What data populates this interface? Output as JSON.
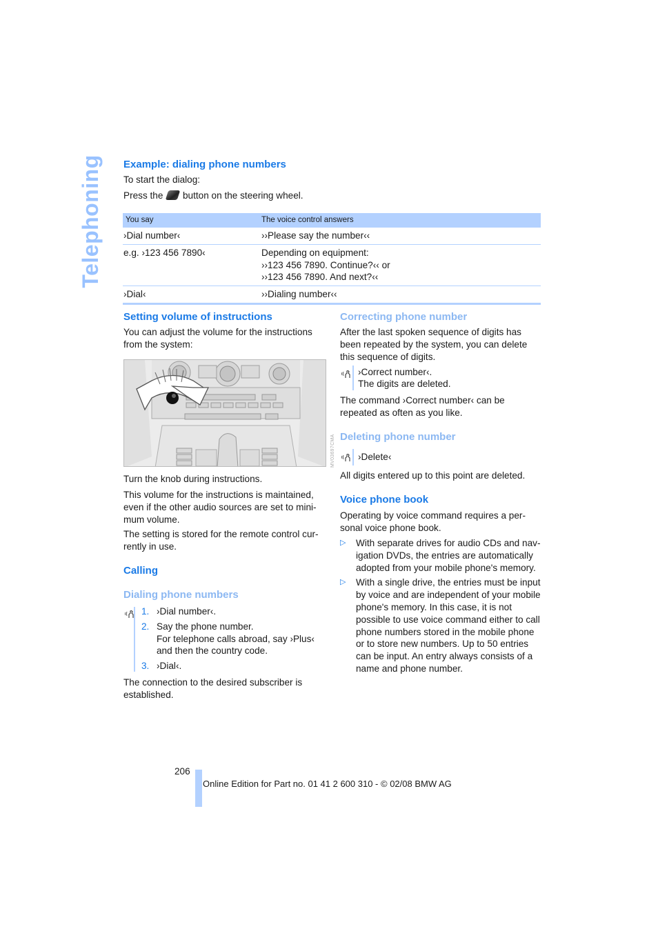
{
  "side_tab": "Telephoning",
  "example": {
    "heading": "Example: dialing phone numbers",
    "intro": "To start the dialog:",
    "press_before": "Press the",
    "press_icon": "steering-wheel-voice-button-icon",
    "press_after": "button on the steering wheel."
  },
  "table": {
    "headers": [
      "You say",
      "The voice control answers"
    ],
    "rows": [
      {
        "you_say": "›Dial number‹",
        "answer": [
          "››Please say the number‹‹"
        ]
      },
      {
        "you_say": "e.g. ›123 456 7890‹",
        "answer": [
          "Depending on equipment:",
          "››123 456 7890. Continue?‹‹ or",
          "››123 456 7890. And next?‹‹"
        ]
      },
      {
        "you_say": "›Dial‹",
        "answer": [
          "››Dialing number‹‹"
        ]
      }
    ]
  },
  "volume": {
    "heading": "Setting volume of instructions",
    "intro": "You can adjust the volume for the instructions from the system:",
    "figure_code": "MV03697CMA",
    "p1": "Turn the knob during instructions.",
    "p2": "This volume for the instructions is maintained, even if the other audio sources are set to mini-mum volume.",
    "p3": "The setting is stored for the remote control cur-rently in use."
  },
  "calling": {
    "heading": "Calling",
    "subheading": "Dialing phone numbers",
    "voice_icon": "voice-command-icon",
    "steps": [
      {
        "num": "1.",
        "lines": [
          "›Dial number‹."
        ]
      },
      {
        "num": "2.",
        "lines": [
          "Say the phone number.",
          "For telephone calls abroad, say ›Plus‹ and then the country code."
        ]
      },
      {
        "num": "3.",
        "lines": [
          "›Dial‹."
        ]
      }
    ],
    "result": "The connection to the desired subscriber is established."
  },
  "correcting": {
    "heading": "Correcting phone number",
    "intro": "After the last spoken sequence of digits has been repeated by the system, you can delete this sequence of digits.",
    "command": "›Correct number‹.",
    "command_result": "The digits are deleted.",
    "note": "The command ›Correct number‹ can be repeated as often as you like."
  },
  "deleting": {
    "heading": "Deleting phone number",
    "command": "›Delete‹",
    "note": "All digits entered up to this point are deleted."
  },
  "phonebook": {
    "heading": "Voice phone book",
    "intro": "Operating by voice command requires a per-sonal voice phone book.",
    "bullets": [
      "With separate drives for audio CDs and nav-igation DVDs, the entries are automatically adopted from your mobile phone's memory.",
      "With a single drive, the entries must be input by voice and are independent of your mobile phone's memory. In this case, it is not possible to use voice command either to call phone numbers stored in the mobile phone or to store new numbers. Up to 50 entries can be input. An entry always consists of a name and phone number."
    ]
  },
  "footer": {
    "page_number": "206",
    "edition": "Online Edition for Part no. 01 41 2 600 310 - © 02/08 BMW AG"
  },
  "colors": {
    "heading_blue": "#1a7ae6",
    "heading_light_blue": "#8cb8f2",
    "table_header_bg": "#b3d1ff",
    "side_tab": "#99c2ff"
  }
}
